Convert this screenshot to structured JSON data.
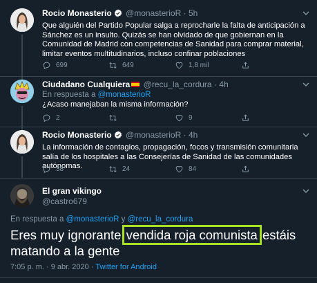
{
  "tweets": [
    {
      "name": "Rocio Monasterio",
      "handle": "@monasterioR",
      "time": "5h",
      "text": "Que alguién del Partido Popular salga a reprocharle la falta de anticipación a Sánchez es un insulto. Quizás se han olvidado de que gobiernan en la Comunidad de Madrid con competencias de Sanidad para comprar material, limitar eventos multitudinarios, incluso confinar poblaciones",
      "replies": "699",
      "retweets": "649",
      "likes": "1,8 mil"
    },
    {
      "name": "Ciudadano Cualquiera",
      "handle": "@recu_la_cordura",
      "time": "4h",
      "reply_prefix": "En respuesta a",
      "reply_mention": "@monasterioR",
      "text": "¿Acaso manejaban la misma información?",
      "replies": "2",
      "retweets": "",
      "likes": "9"
    },
    {
      "name": "Rocio Monasterio",
      "handle": "@monasterioR",
      "time": "4h",
      "text": "La información de contagios, propagación, focos y transmisión comunitaria salía de los hospitales a las Consejerías de Sanidad de las comunidades autónomas.",
      "replies": "38",
      "retweets": "24",
      "likes": "84"
    }
  ],
  "main_tweet": {
    "name": "El gran vikingo",
    "handle": "@castro679",
    "reply_prefix": "En respuesta a",
    "mention1": "@monasterioR",
    "reply_joiner": "y",
    "mention2": "@recu_la_cordura",
    "text_before": "Eres muy ignorante ",
    "text_highlight": "vendida roja comunista",
    "text_after": " estáis matando a la gente",
    "timestamp": "7:05 p. m. · 9 abr. 2020 · ",
    "source": "Twitter for Android"
  },
  "icons": {
    "reply": "reply-icon",
    "retweet": "retweet-icon",
    "like": "heart-icon",
    "share": "share-icon",
    "verified": "verified-badge-icon",
    "caret": "chevron-down-icon"
  },
  "colors": {
    "background": "#15202b",
    "secondary": "#8899a6",
    "link": "#1da1f2",
    "highlight": "#a8e023"
  }
}
